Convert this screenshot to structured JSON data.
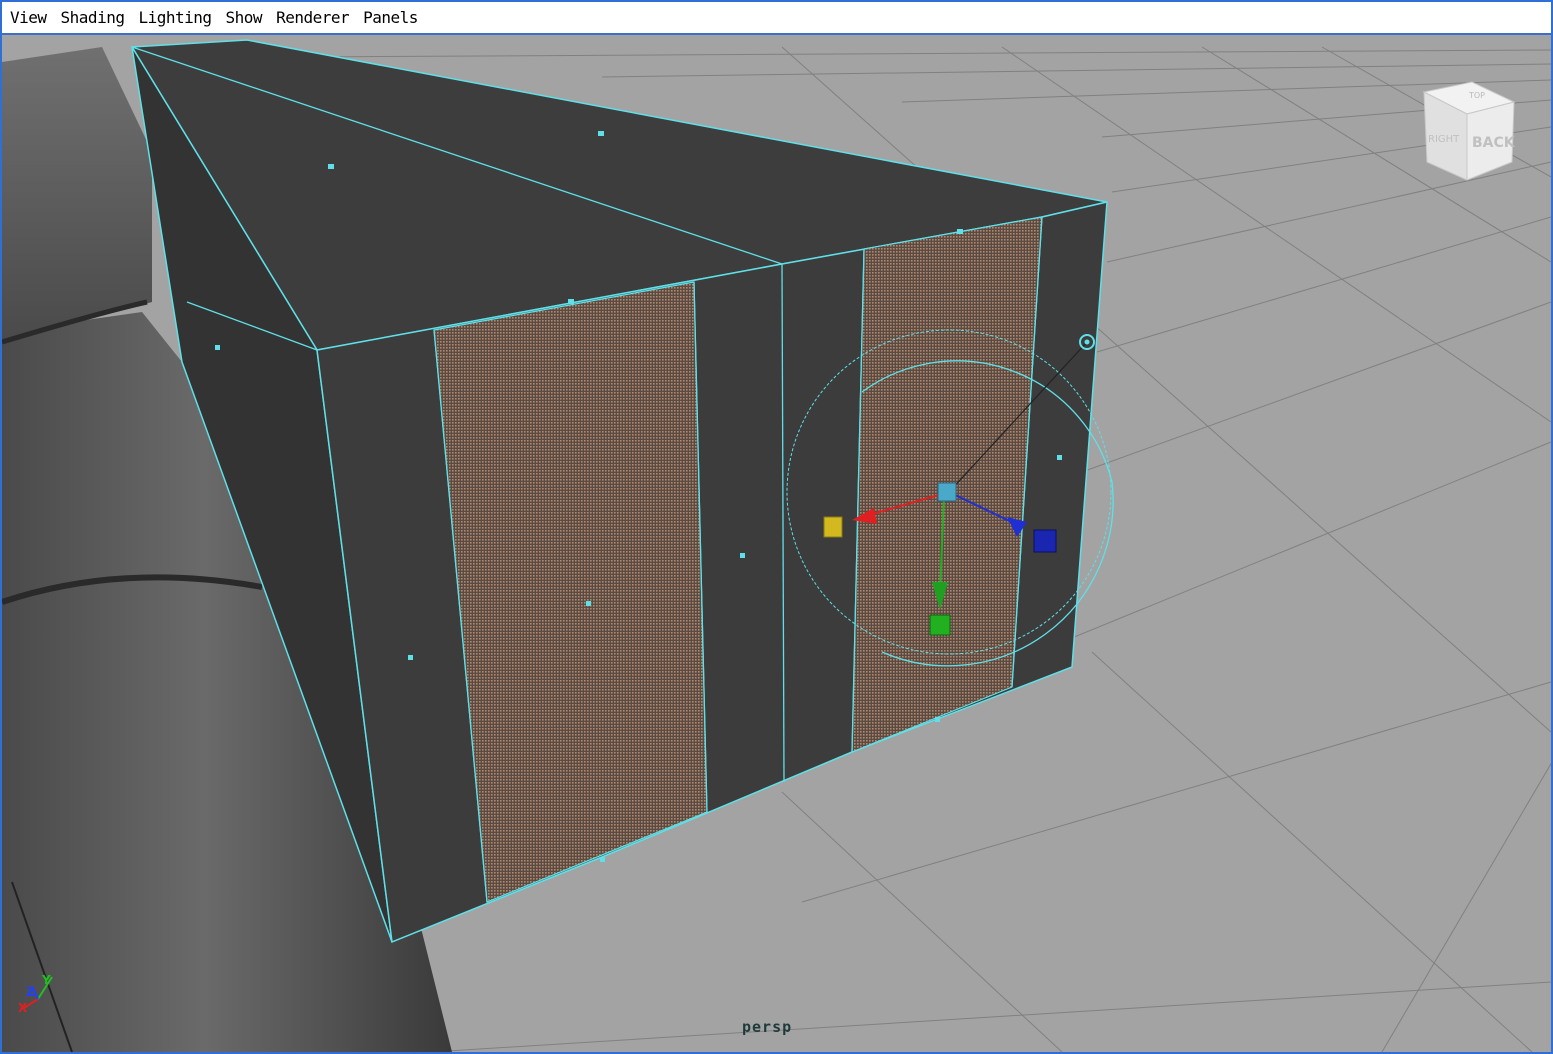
{
  "menubar": {
    "items": [
      {
        "label": "View"
      },
      {
        "label": "Shading"
      },
      {
        "label": "Lighting"
      },
      {
        "label": "Show"
      },
      {
        "label": "Renderer"
      },
      {
        "label": "Panels"
      }
    ]
  },
  "viewport": {
    "camera": "persp",
    "view_cube": {
      "faces": [
        "RIGHT",
        "BACK",
        "TOP"
      ]
    },
    "axis_indicator": {
      "labels": [
        "X",
        "Y",
        "Z"
      ]
    },
    "colors": {
      "background": "#a3a3a3",
      "grid": "#7d7d7d",
      "mesh_face": "#3c3c3c",
      "wireframe": "#5fe0e8",
      "selected_face": "#7a6858",
      "x_axis": "#e02020",
      "y_axis": "#20b020",
      "z_axis": "#2030d0"
    }
  }
}
